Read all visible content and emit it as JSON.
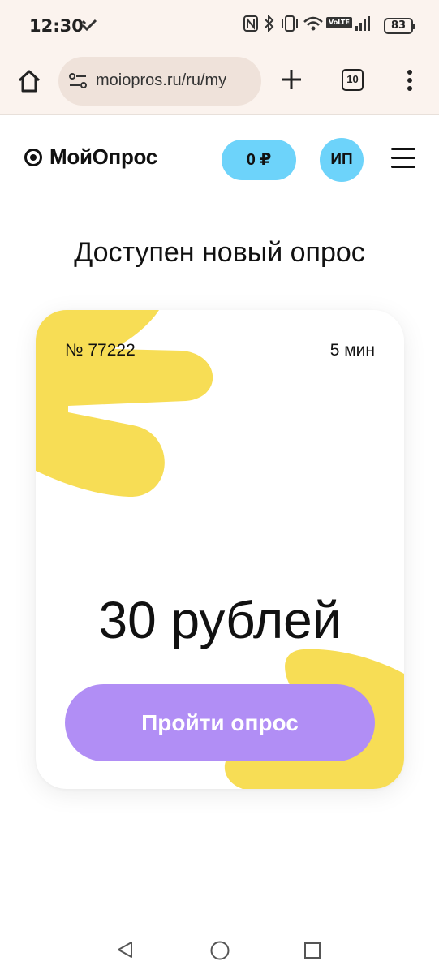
{
  "status_bar": {
    "time": "12:30",
    "battery": "83",
    "volte": "VoLTE"
  },
  "browser": {
    "url": "moiopros.ru/ru/my",
    "tab_count": "10"
  },
  "header": {
    "logo": "МойОпрос",
    "balance": "0 ₽",
    "avatar_initials": "ИП"
  },
  "page": {
    "title": "Доступен новый опрос"
  },
  "survey_card": {
    "number": "№ 77222",
    "duration": "5 мин",
    "reward": "30 рублей",
    "cta_label": "Пройти опрос"
  },
  "colors": {
    "accent_blue": "#6dd3fa",
    "cta_purple": "#b18ef5",
    "blob_yellow": "#f7dd55",
    "browser_bar": "#fbf3ee"
  }
}
